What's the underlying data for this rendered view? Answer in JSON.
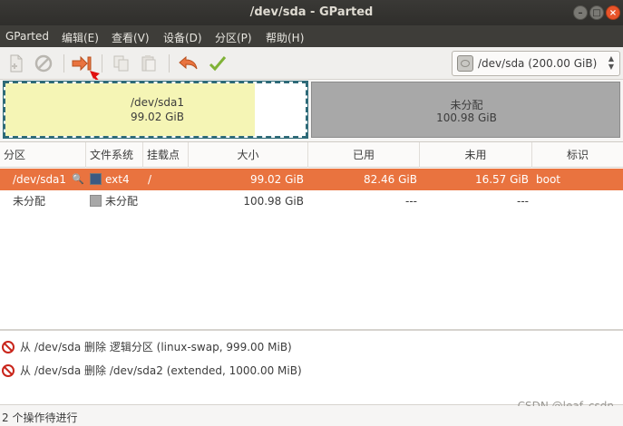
{
  "window": {
    "title": "/dev/sda - GParted"
  },
  "menu": [
    "GParted",
    "编辑(E)",
    "查看(V)",
    "设备(D)",
    "分区(P)",
    "帮助(H)"
  ],
  "toolbar": {
    "icons": [
      "new-partition-icon",
      "delete-icon",
      "resize-move-icon",
      "copy-icon",
      "paste-icon",
      "undo-icon",
      "apply-icon"
    ],
    "device_label": "/dev/sda  (200.00 GiB)"
  },
  "diskmap": {
    "partitions": [
      {
        "name": "/dev/sda1",
        "size": "99.02 GiB",
        "used_fraction": 0.83
      },
      {
        "name": "未分配",
        "size": "100.98 GiB"
      }
    ]
  },
  "table": {
    "columns": [
      "分区",
      "文件系统",
      "挂载点",
      "大小",
      "已用",
      "未用",
      "标识"
    ],
    "rows": [
      {
        "partition": "/dev/sda1",
        "fs": "ext4",
        "fs_color": "#3b5a82",
        "mount": "/",
        "size": "99.02 GiB",
        "used": "82.46 GiB",
        "unused": "16.57 GiB",
        "flags": "boot"
      },
      {
        "partition": "未分配",
        "fs": "未分配",
        "fs_color": "#a8a8a8",
        "mount": "",
        "size": "100.98 GiB",
        "used": "---",
        "unused": "---",
        "flags": ""
      }
    ]
  },
  "operations": [
    "从 /dev/sda 删除 逻辑分区 (linux-swap, 999.00 MiB)",
    "从 /dev/sda 删除 /dev/sda2 (extended, 1000.00 MiB)"
  ],
  "status": "2 个操作待进行",
  "watermark": "CSDN @leaf_csdn",
  "colors": {
    "selected_row": "#e9733f",
    "partition_used": "#f5f5b5",
    "unallocated": "#a8a8a8"
  }
}
